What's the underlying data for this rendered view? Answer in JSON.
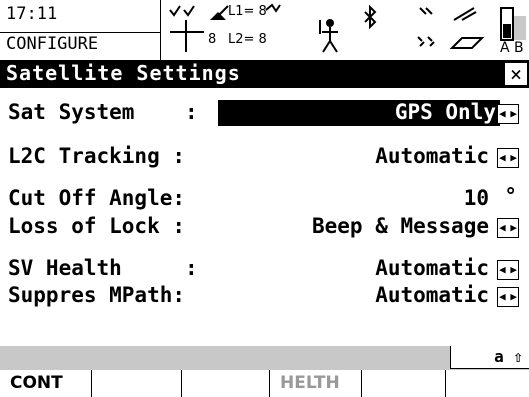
{
  "status": {
    "time": "17:11",
    "mode": "CONFIGURE",
    "gps_l1": "L1= 8",
    "gps_l2": "L2= 8",
    "sat_count": "8",
    "battery_labels": "A B"
  },
  "title": "Satellite Settings",
  "close_icon": "close-icon",
  "fields": [
    {
      "label": "Sat System    :",
      "value": "GPS Only",
      "selected": true
    },
    {
      "label": "L2C Tracking :",
      "value": "Automatic"
    },
    {
      "label": "Cut Off Angle:",
      "value": "10",
      "unit": "°"
    },
    {
      "label": "Loss of Lock :",
      "value": "Beep & Message"
    },
    {
      "label": "SV Health     :",
      "value": "Automatic"
    },
    {
      "label": "Suppres MPath:",
      "value": "Automatic"
    }
  ],
  "input_indicator": "a ⇧",
  "softkeys": [
    {
      "label": "CONT",
      "enabled": true
    },
    {
      "label": "",
      "enabled": false
    },
    {
      "label": "",
      "enabled": false
    },
    {
      "label": "HELTH",
      "enabled": false
    },
    {
      "label": "",
      "enabled": false
    },
    {
      "label": "",
      "enabled": false
    }
  ]
}
